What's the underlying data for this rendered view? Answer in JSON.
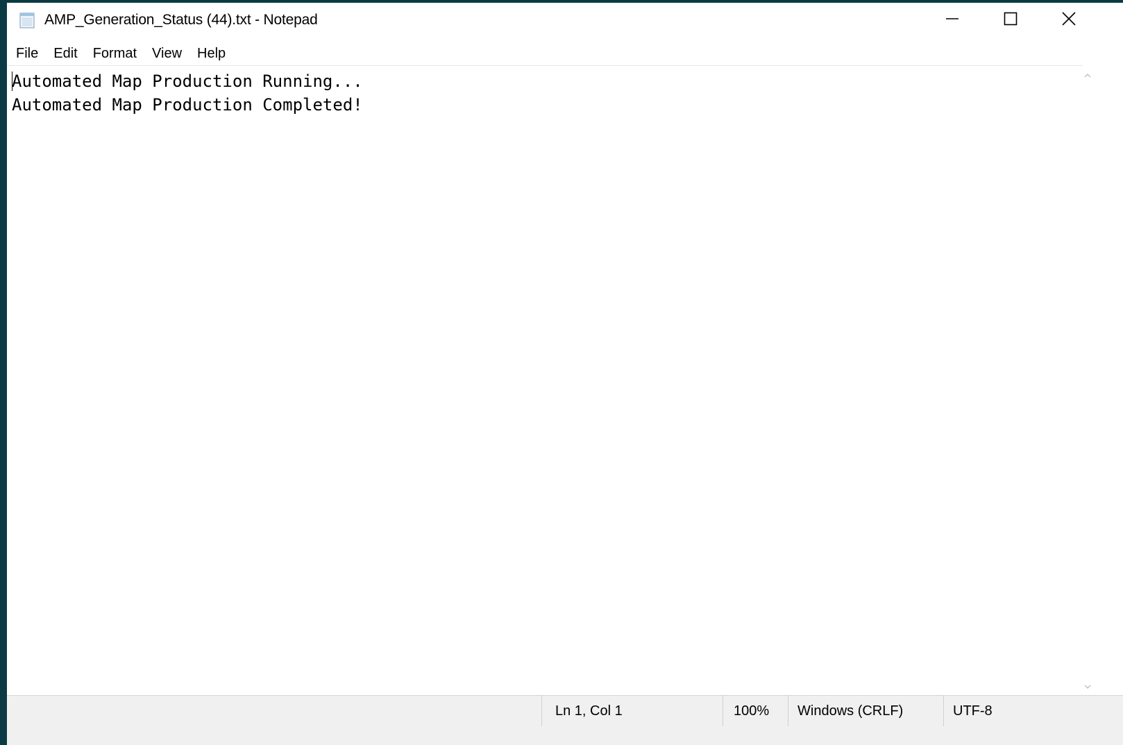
{
  "window": {
    "title": "AMP_Generation_Status (44).txt - Notepad",
    "icon": "notepad-icon",
    "controls": {
      "minimize": "minimize-icon",
      "maximize": "maximize-icon",
      "close": "close-icon"
    }
  },
  "menu": {
    "items": [
      "File",
      "Edit",
      "Format",
      "View",
      "Help"
    ]
  },
  "editor": {
    "lines": [
      "Automated Map Production Running...",
      "Automated Map Production Completed!"
    ]
  },
  "status": {
    "position": "Ln 1, Col 1",
    "zoom": "100%",
    "line_ending": "Windows (CRLF)",
    "encoding": "UTF-8"
  },
  "colors": {
    "desktop_background": "#0b3a44",
    "window_background": "#ffffff",
    "statusbar_background": "#f0f0f0"
  }
}
